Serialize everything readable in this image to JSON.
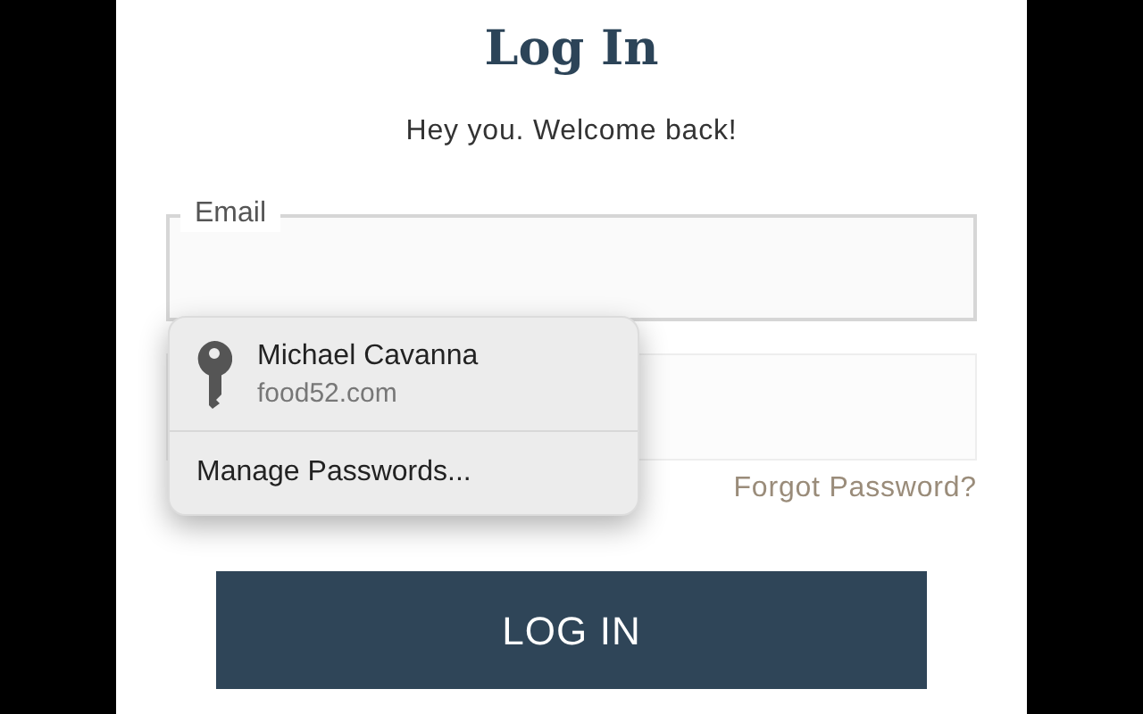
{
  "title": "Log In",
  "subtitle": "Hey you. Welcome back!",
  "email_field": {
    "label": "Email"
  },
  "forgot_link": "Forgot Password?",
  "login_button": "LOG IN",
  "autofill_popup": {
    "accounts": [
      {
        "name": "Michael Cavanna",
        "site": "food52.com"
      }
    ],
    "manage": "Manage Passwords..."
  }
}
